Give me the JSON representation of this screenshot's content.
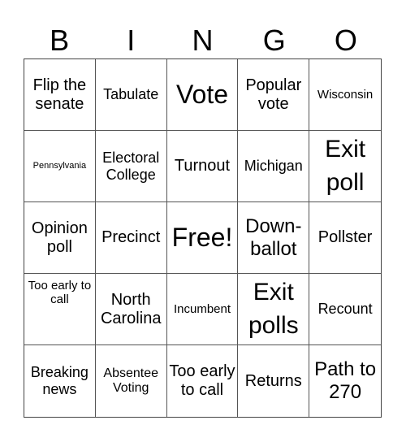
{
  "header": {
    "letters": [
      "B",
      "I",
      "N",
      "G",
      "O"
    ]
  },
  "cells": [
    "Flip the senate",
    "Tabulate",
    "Vote",
    "Popular vote",
    "Wisconsin",
    "Pennsylvania",
    "Electoral College",
    "Turnout",
    "Michigan",
    "Exit poll",
    "Opinion poll",
    "Precinct",
    "Free!",
    "Down-ballot",
    "Pollster",
    "Too early to call",
    "North Carolina",
    "Incumbent",
    "Exit polls",
    "Recount",
    "Breaking news",
    "Absentee Voting",
    "Too early to call",
    "Returns",
    "Path to 270"
  ]
}
